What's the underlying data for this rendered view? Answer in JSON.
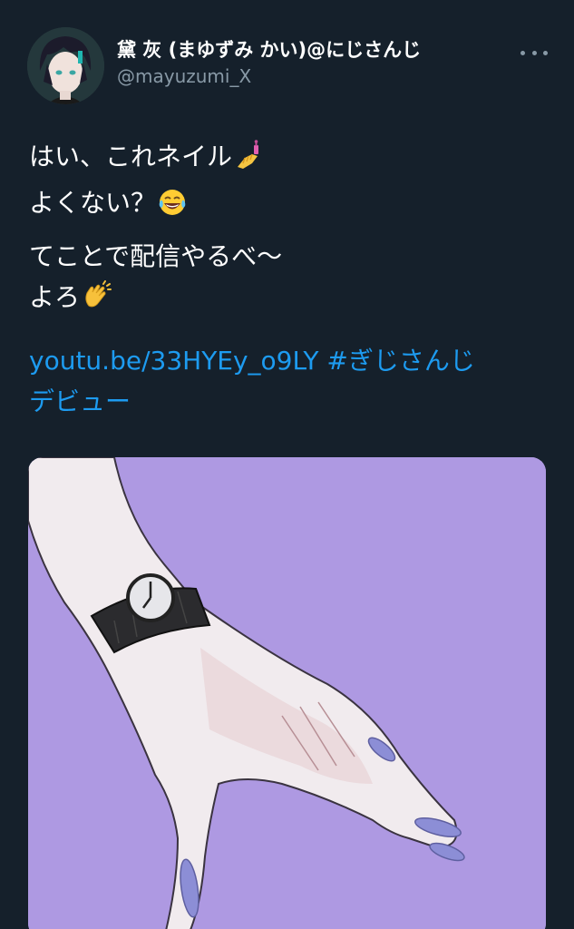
{
  "tweet": {
    "display_name": "黛 灰 (まゆずみ かい)@にじさんじ",
    "handle": "@mayuzumi_X",
    "more_label": "More",
    "line1": "はい、これネイル",
    "line2": "よくない？",
    "line3": "てことで配信やるべ〜",
    "line4": "よろ",
    "link_url": "youtu.be/33HYEy_o9LY",
    "hashtag_part1": "#ぎじさんじ",
    "hashtag_part2": "デビュー"
  },
  "icons": [
    "nail-polish-icon",
    "laughing-tears-icon",
    "clapping-hands-icon",
    "more-dots-icon"
  ],
  "colors": {
    "background": "#15202b",
    "text": "#ffffff",
    "secondary_text": "#8899a6",
    "link": "#1d9bf0",
    "media_background": "#ae99e2"
  }
}
